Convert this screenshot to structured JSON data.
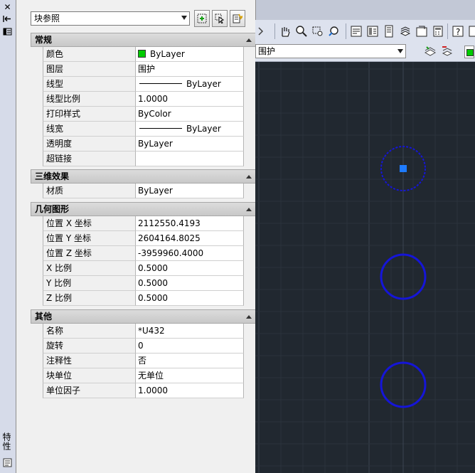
{
  "palette": {
    "object_type": "块参照",
    "vertical_title": "特性",
    "sections": [
      {
        "title": "常规",
        "rows": [
          {
            "key": "颜色",
            "value": "ByLayer",
            "swatch": "#00cc00"
          },
          {
            "key": "图层",
            "value": "围护"
          },
          {
            "key": "线型",
            "value": "ByLayer",
            "line": true
          },
          {
            "key": "线型比例",
            "value": "1.0000"
          },
          {
            "key": "打印样式",
            "value": "ByColor"
          },
          {
            "key": "线宽",
            "value": "ByLayer",
            "line": true
          },
          {
            "key": "透明度",
            "value": "ByLayer"
          },
          {
            "key": "超链接",
            "value": ""
          }
        ]
      },
      {
        "title": "三维效果",
        "rows": [
          {
            "key": "材质",
            "value": "ByLayer"
          }
        ]
      },
      {
        "title": "几何图形",
        "rows": [
          {
            "key": "位置 X 坐标",
            "value": "2112550.4193"
          },
          {
            "key": "位置 Y 坐标",
            "value": "2604164.8025"
          },
          {
            "key": "位置 Z 坐标",
            "value": "-3959960.4000"
          },
          {
            "key": "X 比例",
            "value": "0.5000"
          },
          {
            "key": "Y 比例",
            "value": "0.5000"
          },
          {
            "key": "Z 比例",
            "value": "0.5000"
          }
        ]
      },
      {
        "title": "其他",
        "rows": [
          {
            "key": "名称",
            "value": "*U432"
          },
          {
            "key": "旋转",
            "value": "0"
          },
          {
            "key": "注释性",
            "value": "否"
          },
          {
            "key": "块单位",
            "value": "无单位"
          },
          {
            "key": "单位因子",
            "value": "1.0000"
          }
        ]
      }
    ]
  },
  "layer_toolbar": {
    "current_layer": "围护"
  },
  "colors": {
    "canvas_bg": "#212830",
    "circle": "#1515d8",
    "grip": "#1e7bff",
    "layer_swatch": "#00cc00"
  }
}
